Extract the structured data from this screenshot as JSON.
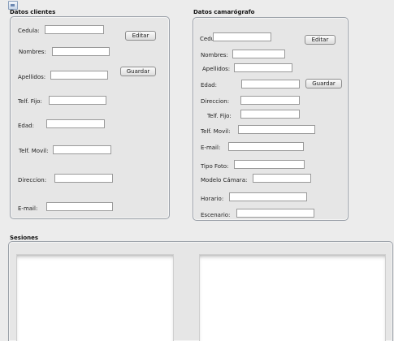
{
  "window": {
    "icon": "app-window-icon"
  },
  "clientes": {
    "title": "Datos clientes",
    "fields": {
      "cedula": {
        "label": "Cedula:",
        "value": ""
      },
      "nombres": {
        "label": "Nombres:",
        "value": ""
      },
      "apellidos": {
        "label": "Apellidos:",
        "value": ""
      },
      "telf_fijo": {
        "label": "Telf. Fijo:",
        "value": ""
      },
      "edad": {
        "label": "Edad:",
        "value": ""
      },
      "telf_movil": {
        "label": "Telf. Movil:",
        "value": ""
      },
      "direccion": {
        "label": "Direccion:",
        "value": ""
      },
      "email": {
        "label": "E-mail:",
        "value": ""
      }
    },
    "buttons": {
      "editar": "Editar",
      "guardar": "Guardar"
    }
  },
  "camarografo": {
    "title": "Datos camarógrafo",
    "fields": {
      "cedula": {
        "label": "Cedula:",
        "value": ""
      },
      "nombres": {
        "label": "Nombres:",
        "value": ""
      },
      "apellidos": {
        "label": "Apellidos:",
        "value": ""
      },
      "edad": {
        "label": "Edad:",
        "value": ""
      },
      "direccion": {
        "label": "Direccion:",
        "value": ""
      },
      "telf_fijo": {
        "label": "Telf. Fijo:",
        "value": ""
      },
      "telf_movil": {
        "label": "Telf. Movil:",
        "value": ""
      },
      "email": {
        "label": "E-mail:",
        "value": ""
      },
      "tipo_foto": {
        "label": "Tipo Foto:",
        "value": ""
      },
      "modelo_camara": {
        "label": "Modelo Cámara:",
        "value": ""
      },
      "horario": {
        "label": "Horario:",
        "value": ""
      },
      "escenario": {
        "label": "Escenario:",
        "value": ""
      }
    },
    "buttons": {
      "editar": "Editar",
      "guardar": "Guardar"
    }
  },
  "sesiones": {
    "title": "Sesiones"
  }
}
